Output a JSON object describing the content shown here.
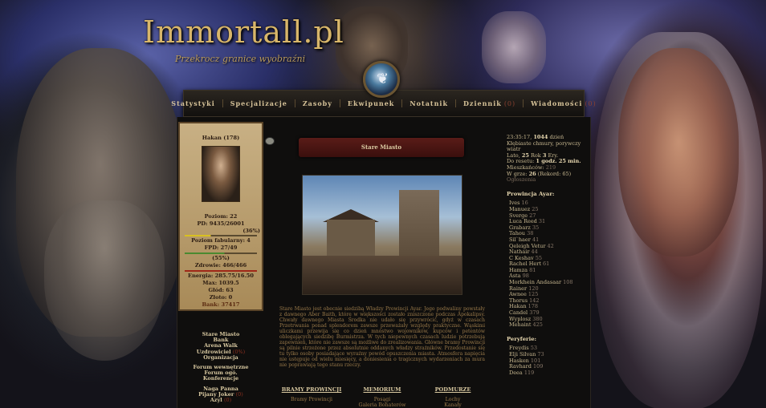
{
  "header": {
    "logo": "Immortall.pl",
    "tagline": "Przekrocz granice wyobraźni"
  },
  "nav": [
    {
      "label": "Statystyki",
      "count": ""
    },
    {
      "label": "Specjalizacje",
      "count": ""
    },
    {
      "label": "Zasoby",
      "count": ""
    },
    {
      "label": "Ekwipunek",
      "count": ""
    },
    {
      "label": "Notatnik",
      "count": ""
    },
    {
      "label": "Dziennik",
      "count": "(0)"
    },
    {
      "label": "Wiadomości",
      "count": "(0)"
    }
  ],
  "player": {
    "name": "Hakan (178)",
    "level": "Poziom: 22",
    "pd": "PD: 9435/26001",
    "pd_pct": "(36%)",
    "story": "Poziom fabularny: 4",
    "fpd": "FPD: 27/49",
    "fpd_pct": "(55%)",
    "health": "Zdrowie: 466/466",
    "energy": "Energia: 285.75/16.50 Max: 1039.5",
    "hunger": "Głód: 63",
    "gold": "Złoto: 0",
    "bank": "Bank: 37417"
  },
  "left_links": [
    "Stare Miasto",
    "Bank",
    "Arena Walk",
    "Uzdrowiciel",
    "Organizacja",
    "Forum wewnętrzne",
    "Forum ogó.",
    "Konferencje",
    "Naga Panna",
    "Pijany Joker",
    "Azyl"
  ],
  "left_counts": {
    "Uzdrowiciel": "(0%)",
    "Pijany Joker": "(0)",
    "Azyl": "(0)"
  },
  "location": {
    "title": "Stare Miasto",
    "description": "Stare Miasto jest obecnie siedzibą Władzy Prowincji Ayar. Jego podwaliny powstały z dawnego Aber Baith, które w większości zostało zniszczone podczas Apokalipsy. Chwały dawnego Miasta Środka nie udało się przywrócić, gdyż w czasach Przetrwania ponad splendorem zawsze przeważały względy praktyczne. Wąskimi uliczkami przewija się co dzień mnóstwo wojowników, kupców i petentów oblegających siedzibę Burmistrza. W tych niepewnych czasach ludzie potrzebują zapewnień, które nie zawsze są możliwe do zrealizowania. Główne bramy Prowincji są pilnie strzeżone przez absolutnie oddanych władzy strażników. Przedostanie się tu tylko osoby posiadające wyraźny powód opuszczenia miasta. Atmosfera napięcia nie ustępuje od wielu miesięcy, a doniesienia o tragicznych wydarzeniach za mura nie poprawiają tego stanu rzeczy.",
    "sections": [
      {
        "title": "BRAMY PROWINCJI",
        "items": [
          "Bramy Prowincji"
        ]
      },
      {
        "title": "MEMORIUM",
        "items": [
          "Posągi",
          "Galeria Bohaterów"
        ]
      },
      {
        "title": "PODMURZE",
        "items": [
          "Lochy",
          "Kanały"
        ]
      }
    ]
  },
  "info": {
    "time": "23:35:17,",
    "day": "1044",
    "day_label": "dzień",
    "weather": "Kłębiaste chmury, porywczy wiatr",
    "season": "Lato,",
    "year": "25",
    "year_label": "Rok",
    "era": "3",
    "era_label": "Ery.",
    "reset_label": "Do resetu:",
    "reset": "1 godz. 25 min.",
    "residents_label": "Mieszkańców:",
    "residents": "219",
    "ingame_label": "W grze:",
    "ingame": "26",
    "record": "(Rekord: 65)",
    "announcements": "Ogłoszenia"
  },
  "province_title": "Prowincja Ayar:",
  "province": [
    {
      "name": "Ives",
      "id": "16"
    },
    {
      "name": "Manuez",
      "id": "25"
    },
    {
      "name": "Sverge",
      "id": "27"
    },
    {
      "name": "Luca Reed",
      "id": "31"
    },
    {
      "name": "Grabarz",
      "id": "35"
    },
    {
      "name": "Tahou",
      "id": "38"
    },
    {
      "name": "Sil`haer",
      "id": "41"
    },
    {
      "name": "Qeleigh Vetur",
      "id": "42"
    },
    {
      "name": "Nathair",
      "id": "44"
    },
    {
      "name": "C Keshav",
      "id": "55"
    },
    {
      "name": "Rachel Hert",
      "id": "61"
    },
    {
      "name": "Hamza",
      "id": "81"
    },
    {
      "name": "Asta",
      "id": "98"
    },
    {
      "name": "Morkhein Andasaar",
      "id": "108"
    },
    {
      "name": "Rainer",
      "id": "120"
    },
    {
      "name": "Awnee",
      "id": "125"
    },
    {
      "name": "Thorus",
      "id": "142"
    },
    {
      "name": "Hakan",
      "id": "178"
    },
    {
      "name": "Candel",
      "id": "379"
    },
    {
      "name": "Wyplosz",
      "id": "380"
    },
    {
      "name": "Mehaint",
      "id": "425"
    }
  ],
  "periphery_title": "Peryferie:",
  "periphery": [
    {
      "name": "Freydis",
      "id": "53"
    },
    {
      "name": "Elji Silvan",
      "id": "73"
    },
    {
      "name": "Hasken",
      "id": "101"
    },
    {
      "name": "Ravhard",
      "id": "109"
    },
    {
      "name": "Deea",
      "id": "119"
    }
  ]
}
